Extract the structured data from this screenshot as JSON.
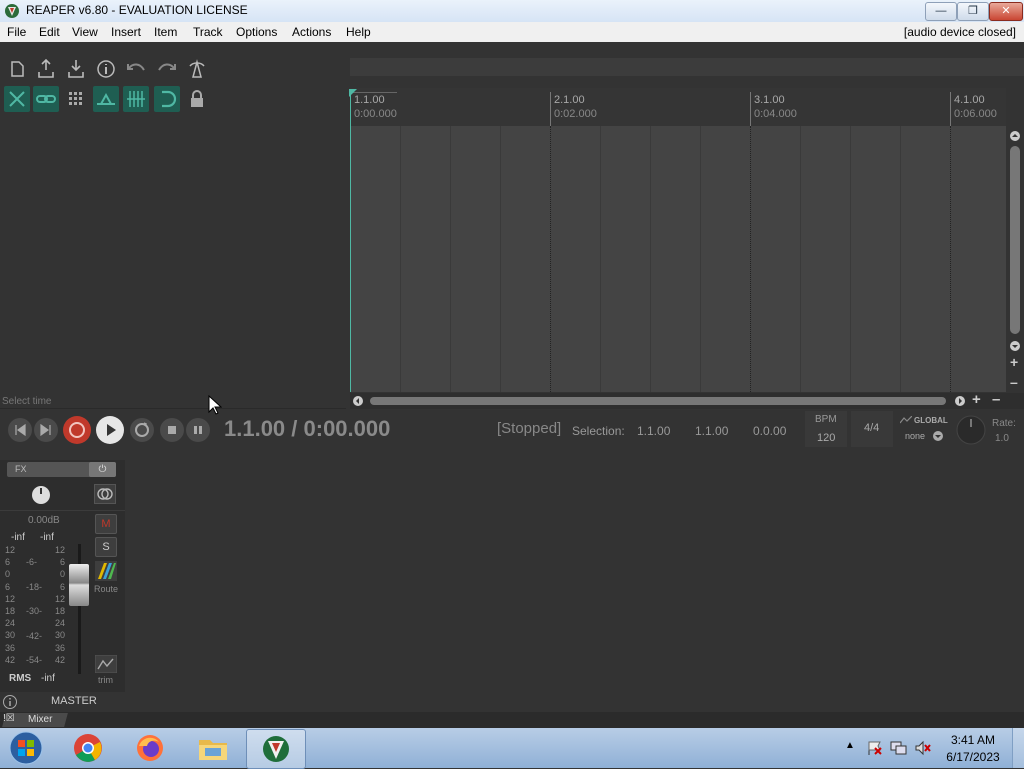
{
  "window": {
    "title": "REAPER v6.80 - EVALUATION LICENSE"
  },
  "menubar": {
    "items": [
      "File",
      "Edit",
      "View",
      "Insert",
      "Item",
      "Track",
      "Options",
      "Actions",
      "Help"
    ],
    "status": "[audio device closed]"
  },
  "ruler": {
    "markers": [
      {
        "bar": "1.1.00",
        "time": "0:00.000"
      },
      {
        "bar": "2.1.00",
        "time": "0:02.000"
      },
      {
        "bar": "3.1.00",
        "time": "0:04.000"
      },
      {
        "bar": "4.1.00",
        "time": "0:06.000"
      }
    ]
  },
  "tcp": {
    "hint": "Select time"
  },
  "transport": {
    "position": "1.1.00 / 0:00.000",
    "state": "[Stopped]",
    "selection_label": "Selection:",
    "selection_start": "1.1.00",
    "selection_end": "1.1.00",
    "selection_length": "0.0.00",
    "bpm_label": "BPM",
    "bpm_value": "120",
    "time_signature": "4/4",
    "global_label": "GLOBAL",
    "global_value": "none",
    "rate_label": "Rate:",
    "rate_value": "1.0"
  },
  "master": {
    "fx_label": "FX",
    "volume": "0.00dB",
    "peak_left": "-inf",
    "peak_right": "-inf",
    "scale_left": [
      "12",
      "6",
      "0",
      "6",
      "12",
      "18",
      "24",
      "30",
      "36",
      "42"
    ],
    "scale_mid": [
      "-6-",
      "-18-",
      "-30-",
      "-42-",
      "-54-"
    ],
    "scale_right": [
      "12",
      "6",
      "0",
      "6",
      "12",
      "18",
      "24",
      "30",
      "36",
      "42"
    ],
    "mute": "M",
    "solo": "S",
    "route": "Route",
    "trim": "trim",
    "rms_label": "RMS",
    "rms_value": "-inf",
    "name": "MASTER"
  },
  "dock": {
    "tab_label": "Mixer"
  },
  "taskbar": {
    "time": "3:41 AM",
    "date": "6/17/2023"
  },
  "colors": {
    "accent_teal": "#4fb8a4",
    "record_red": "#c0392b",
    "background": "#333333"
  }
}
